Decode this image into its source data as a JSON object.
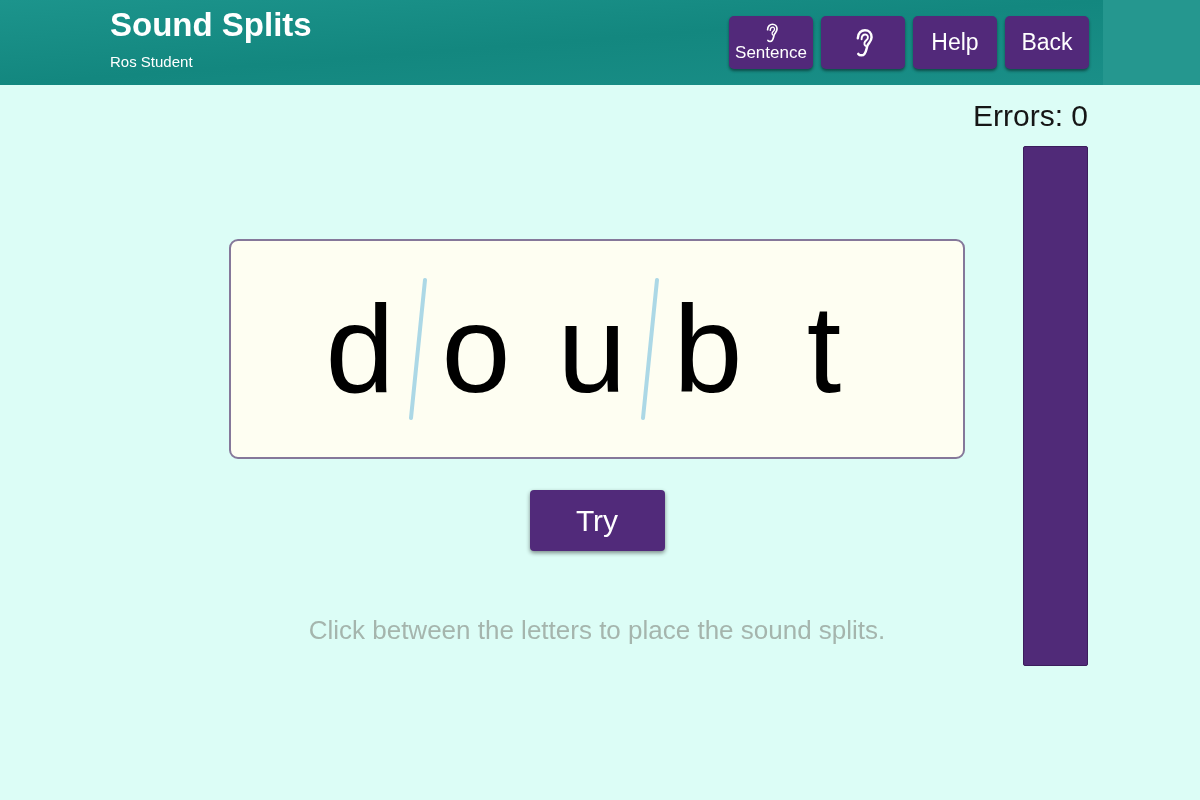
{
  "header": {
    "title": "Sound Splits",
    "user": "Ros Student",
    "buttons": [
      {
        "kind": "ear_label",
        "label": "Sentence"
      },
      {
        "kind": "ear"
      },
      {
        "kind": "text",
        "label": "Help"
      },
      {
        "kind": "text",
        "label": "Back"
      }
    ]
  },
  "errors": "Errors: 0",
  "word": {
    "letters": [
      "d",
      "o",
      "u",
      "b",
      "t"
    ],
    "splits": [
      {
        "placed": true
      },
      {
        "placed": false
      },
      {
        "placed": true
      },
      {
        "placed": false
      }
    ]
  },
  "try_button": "Try",
  "instruction": "Click between the letters to place the sound splits."
}
